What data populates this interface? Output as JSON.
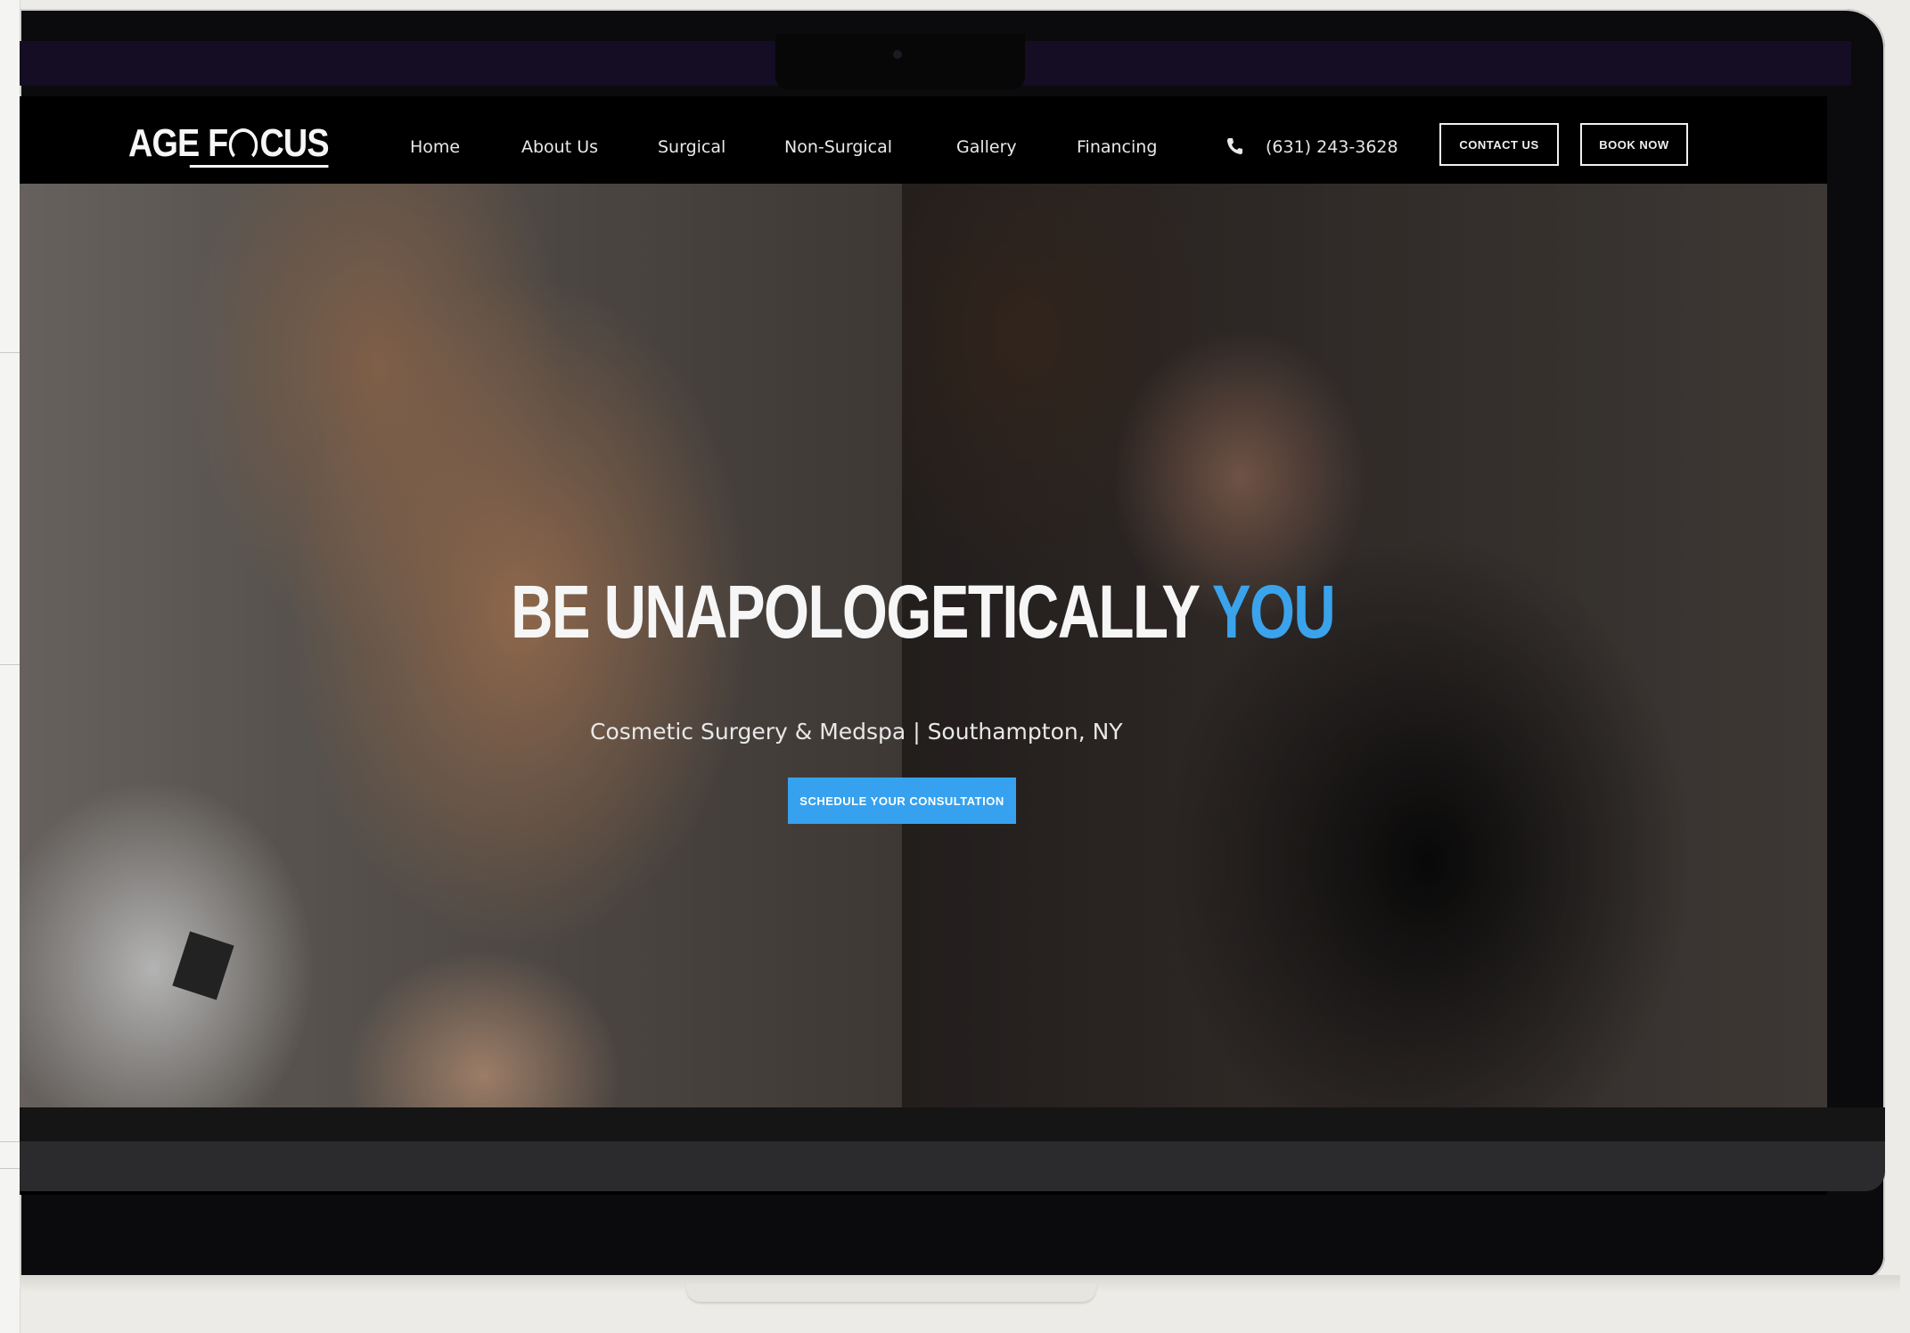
{
  "brand": {
    "logo_text_before": "AGE F",
    "logo_text_after": "CUS"
  },
  "nav": {
    "links": [
      "Home",
      "About Us",
      "Surgical",
      "Non-Surgical",
      "Gallery",
      "Financing"
    ],
    "phone": "(631) 243-3628",
    "contact_button": "CONTACT US",
    "book_button": "BOOK NOW"
  },
  "hero": {
    "headline_main": "BE UNAPOLOGETICALLY",
    "headline_accent": "YOU",
    "subline": "Cosmetic Surgery & Medspa | Southampton, NY",
    "cta_label": "SCHEDULE YOUR CONSULTATION"
  },
  "colors": {
    "accent": "#3aa3ec",
    "navbar": "#000000",
    "cta": "#36a2ef"
  },
  "icons": {
    "phone": "phone-icon",
    "logo_mark": "focus-ring-icon"
  }
}
